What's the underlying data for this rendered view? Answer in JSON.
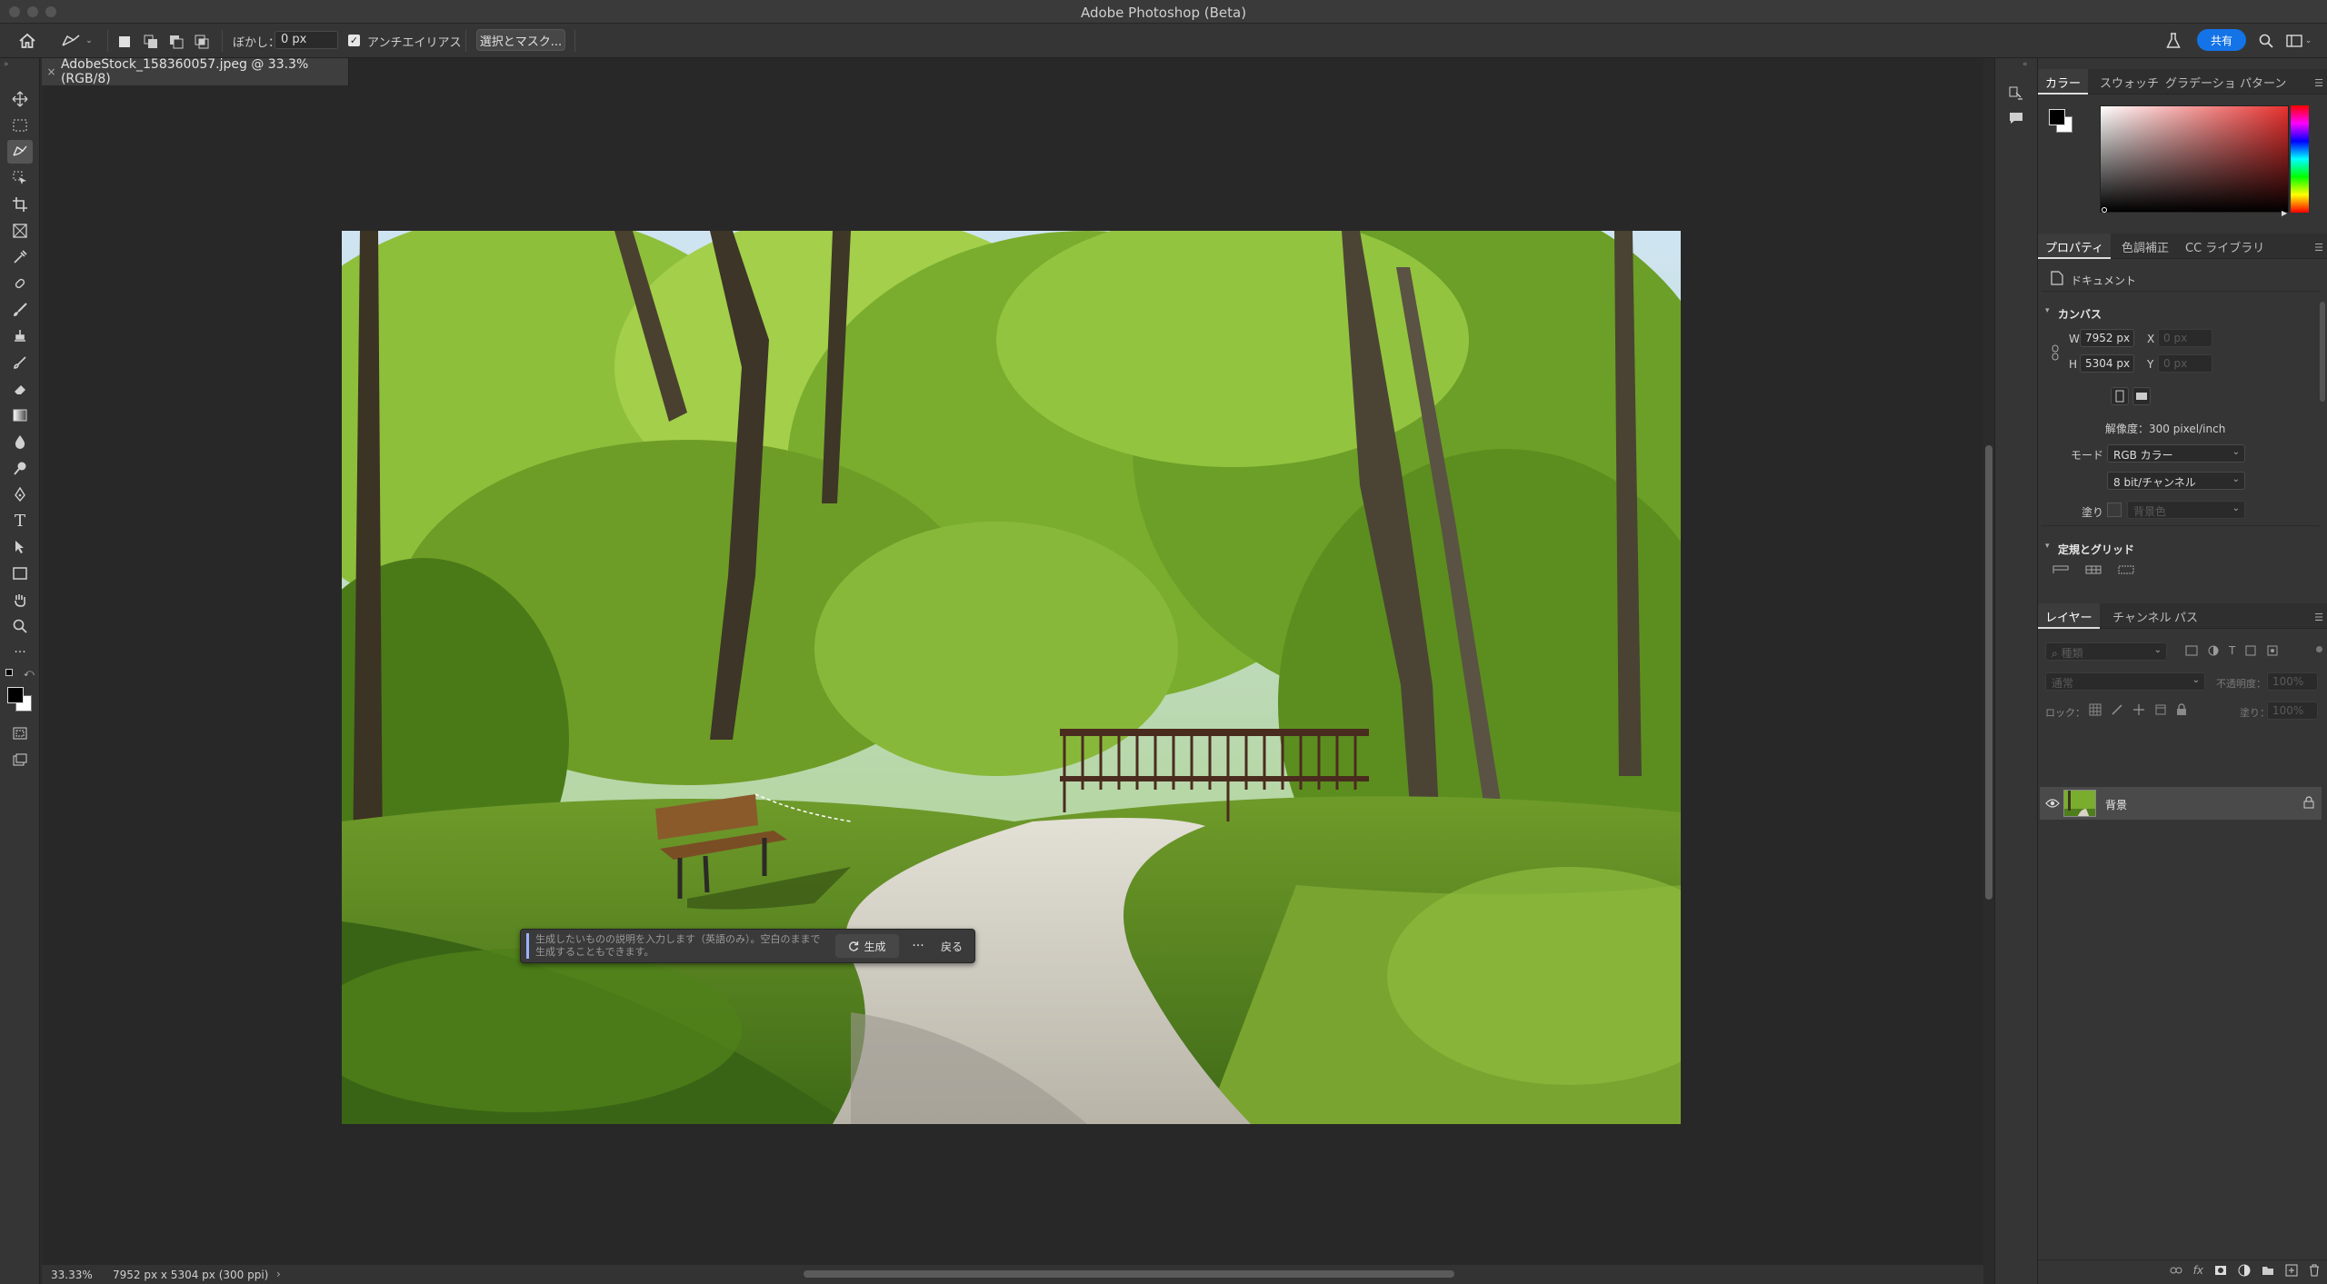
{
  "app": {
    "title": "Adobe Photoshop (Beta)"
  },
  "options": {
    "feather_label": "ぼかし：",
    "feather_value": "0 px",
    "antialias_label": "アンチエイリアス",
    "antialias_checked": true,
    "select_mask_label": "選択とマスク...",
    "share_label": "共有"
  },
  "document": {
    "tab_title": "AdobeStock_158360057.jpeg @ 33.3% (RGB/8)",
    "close_glyph": "×"
  },
  "generative_bar": {
    "placeholder": "生成したいものの説明を入力します（英語のみ）。空白のままで生成することもできます。",
    "generate_label": "生成",
    "more_glyph": "···",
    "back_label": "戻る"
  },
  "status": {
    "zoom": "33.33%",
    "doc_info": "7952 px x 5304 px (300 ppi)",
    "arrow": "›"
  },
  "color_panel": {
    "tabs": [
      "カラー",
      "スウォッチ",
      "グラデーショ",
      "パターン"
    ],
    "active_tab": 0,
    "foreground": "#000000",
    "background": "#ffffff",
    "hue_color": "#e8312f"
  },
  "properties_panel": {
    "tabs": [
      "プロパティ",
      "色調補正",
      "CC ライブラリ"
    ],
    "active_tab": 0,
    "doc_label": "ドキュメント",
    "canvas_header": "カンバス",
    "w_label": "W",
    "w_value": "7952 px",
    "h_label": "H",
    "h_value": "5304 px",
    "x_label": "X",
    "x_placeholder": "0 px",
    "y_label": "Y",
    "y_placeholder": "0 px",
    "resolution": "解像度：300 pixel/inch",
    "mode_label": "モード",
    "mode_value": "RGB カラー",
    "depth_value": "8 bit/チャンネル",
    "fill_label": "塗り",
    "fill_value": "背景色",
    "rulers_header": "定規とグリッド"
  },
  "layers_panel": {
    "tabs": [
      "レイヤー",
      "チャンネル",
      "パス"
    ],
    "active_tab": 0,
    "filter_placeholder": "種類",
    "blend_mode": "通常",
    "opacity_label": "不透明度：",
    "opacity_value": "100%",
    "lock_label": "ロック：",
    "fill_label": "塗り：",
    "fill_value": "100%",
    "layers": [
      {
        "name": "背景",
        "visible": true,
        "locked": true
      }
    ]
  },
  "icons": {
    "home": "home-icon",
    "lasso": "lasso-icon",
    "search": "search-icon",
    "beaker": "beaker-icon",
    "workspace": "workspace-icon"
  },
  "colors": {
    "accent": "#1473e6",
    "selection_line": "#9db1ff"
  }
}
